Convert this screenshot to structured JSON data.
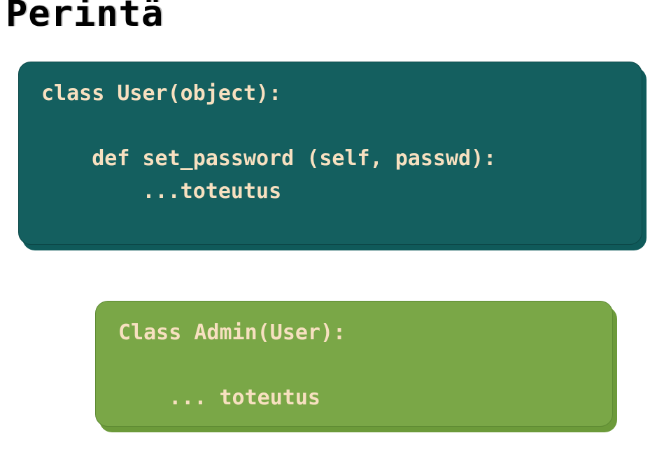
{
  "title": "Perintä",
  "box1": {
    "line1": "class User(object):",
    "line2": "    def set_password (self, passwd):",
    "line3": "        ...toteutus"
  },
  "box2": {
    "line1": "Class Admin(User):",
    "line2": "    ... toteutus"
  }
}
